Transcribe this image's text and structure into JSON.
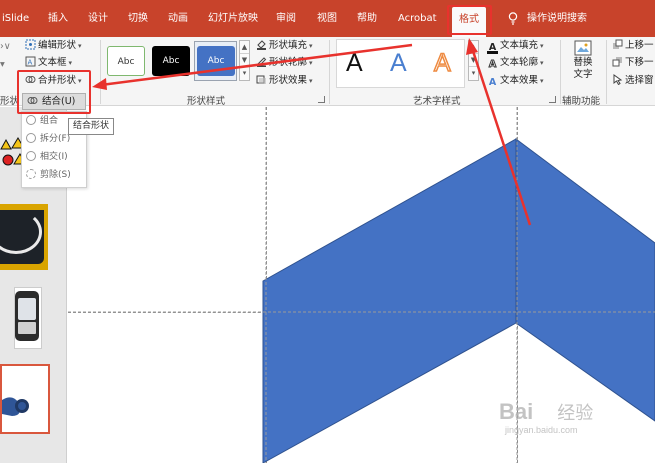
{
  "tabs": [
    {
      "label": "iSlide"
    },
    {
      "label": "插入"
    },
    {
      "label": "设计"
    },
    {
      "label": "切换"
    },
    {
      "label": "动画"
    },
    {
      "label": "幻灯片放映"
    },
    {
      "label": "审阅"
    },
    {
      "label": "视图"
    },
    {
      "label": "帮助"
    },
    {
      "label": "Acrobat"
    },
    {
      "label": "格式",
      "active": true
    }
  ],
  "tell_me": "操作说明搜索",
  "ribbon": {
    "insert_shapes": {
      "edit_shape": "编辑形状",
      "text_box": "文本框",
      "merge_shapes": "合并形状",
      "combine": "结合(U)",
      "group_label_partial": "形状"
    },
    "shape_styles": {
      "label": "形状样式",
      "presets": [
        "Abc",
        "Abc",
        "Abc"
      ],
      "fill": "形状填充",
      "outline": "形状轮廓",
      "effects": "形状效果"
    },
    "wordart": {
      "label": "艺术字样式",
      "letters": [
        "A",
        "A",
        "A"
      ],
      "text_fill": "文本填充",
      "text_outline": "文本轮廓",
      "text_effects": "文本效果"
    },
    "accessibility": {
      "label": "辅助功能",
      "alt_text_line1": "替换",
      "alt_text_line2": "文字"
    },
    "arrange": {
      "bring_forward": "上移一",
      "send_backward": "下移一",
      "selection_pane": "选择窗"
    }
  },
  "merge_menu": {
    "items": [
      "组合",
      "拆分(F)",
      "相交(I)",
      "剪除(S)"
    ],
    "tooltip": "结合形状"
  },
  "colors": {
    "ribbon_tab_bar": "#c8432b",
    "shape_fill": "#4472c4",
    "shape_outline": "#2f528f",
    "annotation_red": "#e8322d"
  },
  "watermark": {
    "brand": "Bai",
    "brand2": "经验",
    "url": "jingyan.baidu.com"
  }
}
